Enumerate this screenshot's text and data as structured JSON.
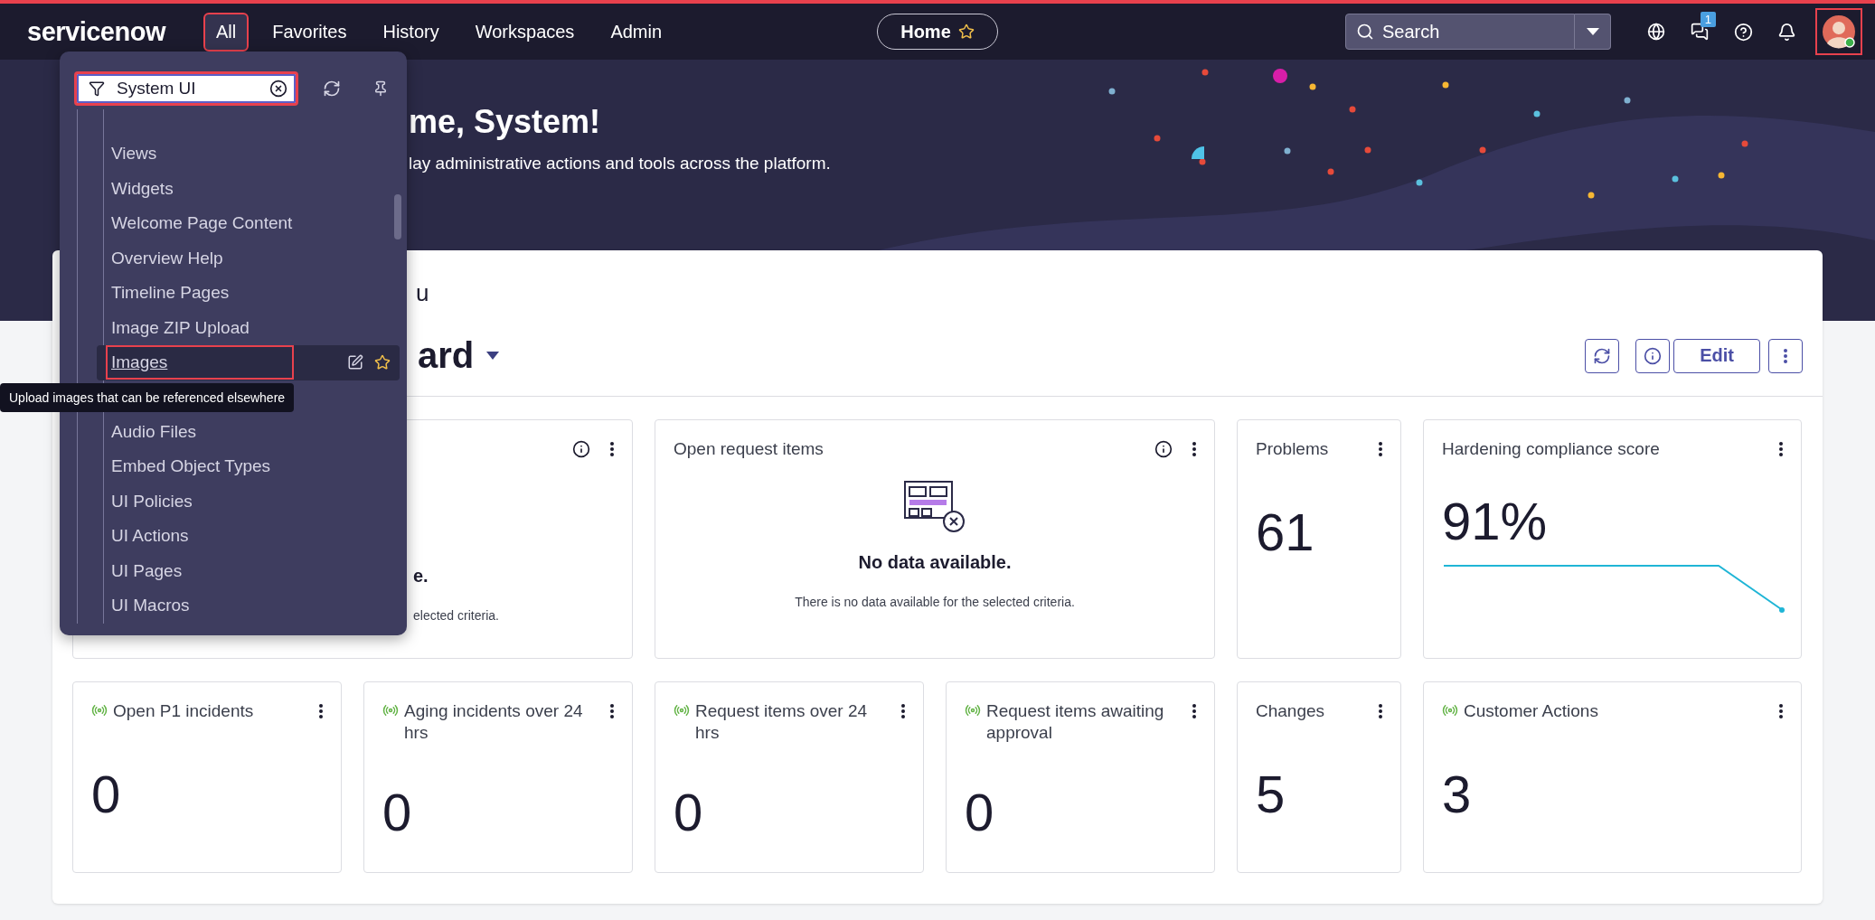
{
  "nav": {
    "logo": "servicenow",
    "items": [
      {
        "label": "All",
        "selected": true,
        "annotated": true
      },
      {
        "label": "Favorites",
        "selected": false,
        "annotated": false
      },
      {
        "label": "History",
        "selected": false,
        "annotated": false
      },
      {
        "label": "Workspaces",
        "selected": false,
        "annotated": false
      },
      {
        "label": "Admin",
        "selected": false,
        "annotated": false
      }
    ],
    "home": {
      "label": "Home"
    },
    "search": {
      "placeholder": "Search"
    },
    "chat_badge": "1",
    "avatar": {
      "annotated": true
    }
  },
  "hero": {
    "title": "me, System!",
    "subtitle": "lay administrative actions and tools across the platform."
  },
  "menu": {
    "filter": {
      "value": "System UI",
      "annotated": true
    },
    "items": [
      {
        "label": "Views",
        "selected": false,
        "annotated": false
      },
      {
        "label": "Widgets",
        "selected": false,
        "annotated": false
      },
      {
        "label": "Welcome Page Content",
        "selected": false,
        "annotated": false
      },
      {
        "label": "Overview Help",
        "selected": false,
        "annotated": false
      },
      {
        "label": "Timeline Pages",
        "selected": false,
        "annotated": false
      },
      {
        "label": "Image ZIP Upload",
        "selected": false,
        "annotated": false
      },
      {
        "label": "Images",
        "selected": true,
        "annotated": true,
        "tooltip": "Upload images that can be referenced elsewhere"
      },
      {
        "label": "Audio Files",
        "selected": false,
        "annotated": false
      },
      {
        "label": "Embed Object Types",
        "selected": false,
        "annotated": false
      },
      {
        "label": "UI Policies",
        "selected": false,
        "annotated": false
      },
      {
        "label": "UI Actions",
        "selected": false,
        "annotated": false
      },
      {
        "label": "UI Pages",
        "selected": false,
        "annotated": false
      },
      {
        "label": "UI Macros",
        "selected": false,
        "annotated": false
      }
    ]
  },
  "dashboard": {
    "section_fragment": "u",
    "title": "ard",
    "actions": [
      {
        "kind": "refresh"
      },
      {
        "kind": "info"
      },
      {
        "kind": "edit",
        "label": "Edit"
      },
      {
        "kind": "more"
      }
    ]
  },
  "cards": [
    {
      "kind": "empty",
      "clipped": true,
      "info": true,
      "empty_title": "e.",
      "empty_text": "elected criteria."
    },
    {
      "kind": "empty",
      "clipped": false,
      "title": "Open request items",
      "info": true,
      "empty_title": "No data available.",
      "empty_text": "There is no data available for the selected criteria."
    },
    {
      "kind": "metric",
      "title": "Problems",
      "live": false,
      "value": "61"
    },
    {
      "kind": "sparkline",
      "title": "Hardening compliance score",
      "live": false,
      "value": "91%"
    },
    {
      "kind": "metric",
      "title": "Open P1 incidents",
      "live": true,
      "value": "0"
    },
    {
      "kind": "metric",
      "title": "Aging incidents over 24 hrs",
      "live": true,
      "value": "0"
    },
    {
      "kind": "metric",
      "title": "Request items over 24 hrs",
      "live": true,
      "value": "0"
    },
    {
      "kind": "metric",
      "title": "Request items awaiting approval",
      "live": true,
      "value": "0"
    },
    {
      "kind": "metric",
      "title": "Changes",
      "live": false,
      "value": "5"
    },
    {
      "kind": "metric",
      "title": "Customer Actions",
      "live": true,
      "value": "3"
    }
  ]
}
